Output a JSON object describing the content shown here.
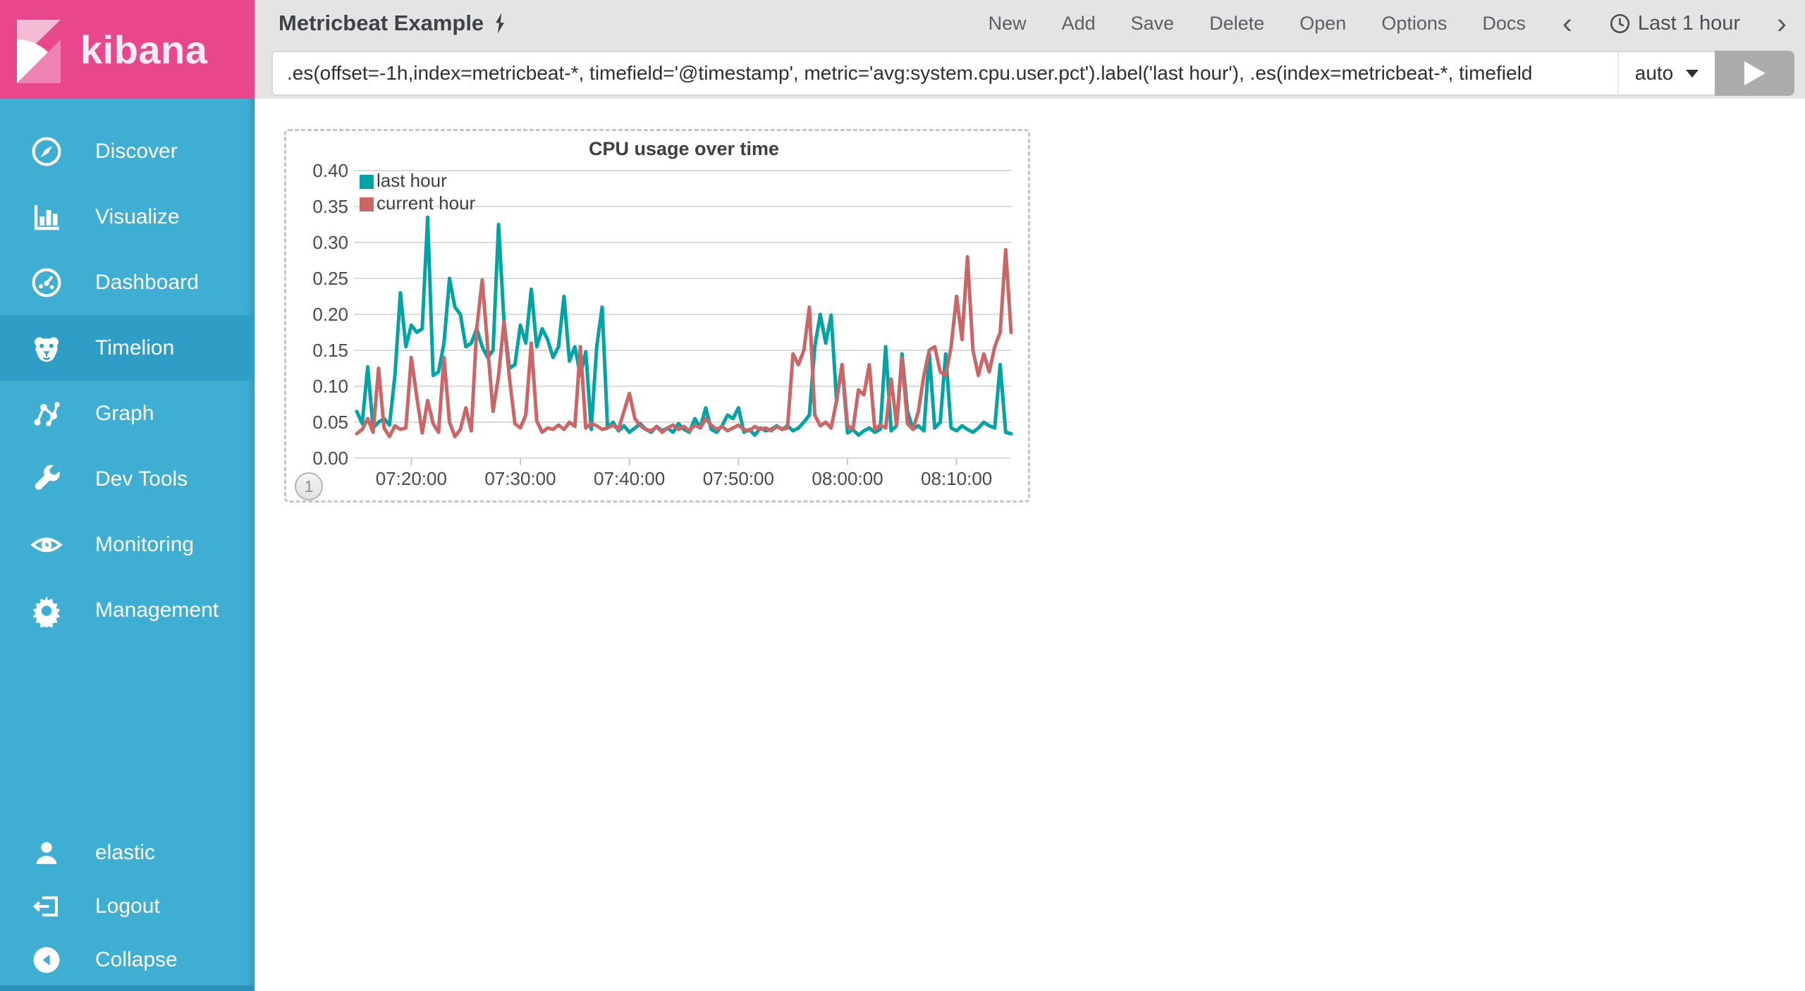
{
  "app": {
    "logo_text": "kibana"
  },
  "sidebar": {
    "items": [
      {
        "label": "Discover",
        "icon": "compass-icon",
        "active": false
      },
      {
        "label": "Visualize",
        "icon": "barchart-icon",
        "active": false
      },
      {
        "label": "Dashboard",
        "icon": "gauge-icon",
        "active": false
      },
      {
        "label": "Timelion",
        "icon": "lion-icon",
        "active": true
      },
      {
        "label": "Graph",
        "icon": "graph-icon",
        "active": false
      },
      {
        "label": "Dev Tools",
        "icon": "wrench-icon",
        "active": false
      },
      {
        "label": "Monitoring",
        "icon": "eye-icon",
        "active": false
      },
      {
        "label": "Management",
        "icon": "gear-icon",
        "active": false
      }
    ],
    "footer_items": [
      {
        "label": "elastic",
        "icon": "user-icon"
      },
      {
        "label": "Logout",
        "icon": "logout-icon"
      },
      {
        "label": "Collapse",
        "icon": "collapse-icon"
      }
    ]
  },
  "topbar": {
    "title": "Metricbeat Example",
    "title_icon": "lightning-bolt-icon",
    "menu": [
      "New",
      "Add",
      "Save",
      "Delete",
      "Open",
      "Options",
      "Docs"
    ],
    "time_picker": {
      "icon": "clock-icon",
      "label": "Last 1 hour"
    }
  },
  "query_bar": {
    "value": ".es(offset=-1h,index=metricbeat-*, timefield='@timestamp', metric='avg:system.cpu.user.pct').label('last hour'), .es(index=metricbeat-*, timefield",
    "interval": "auto",
    "run_icon": "play-icon"
  },
  "panel": {
    "badge": "1"
  },
  "colors": {
    "sidebar": "#3EAED2",
    "sidebar_active": "#2E9EC6",
    "brand_pink": "#E8488B",
    "topbar": "#E4E4E4",
    "series_teal": "#01A4A4",
    "series_red": "#CC6666",
    "grid": "#DBDBDB",
    "axis_text": "#4A4A4A"
  },
  "chart_data": {
    "type": "line",
    "title": "CPU usage over time",
    "xlabel": "",
    "ylabel": "",
    "x_range": [
      "07:15:00",
      "08:15:00"
    ],
    "interval_seconds": 30,
    "x_ticks": [
      "07:20:00",
      "07:30:00",
      "07:40:00",
      "07:50:00",
      "08:00:00",
      "08:10:00"
    ],
    "x_tick_minutes_from_start": [
      5,
      15,
      25,
      35,
      45,
      55
    ],
    "y_ticks": [
      "0.00",
      "0.05",
      "0.10",
      "0.15",
      "0.20",
      "0.25",
      "0.30",
      "0.35",
      "0.40"
    ],
    "ylim": [
      0,
      0.4
    ],
    "grid": true,
    "legend_position": "top-left",
    "series": [
      {
        "name": "last hour",
        "color": "#01A4A4",
        "values": [
          0.065,
          0.048,
          0.127,
          0.042,
          0.05,
          0.055,
          0.046,
          0.115,
          0.23,
          0.155,
          0.185,
          0.175,
          0.18,
          0.335,
          0.115,
          0.12,
          0.16,
          0.25,
          0.21,
          0.2,
          0.155,
          0.16,
          0.18,
          0.155,
          0.14,
          0.15,
          0.325,
          0.19,
          0.125,
          0.13,
          0.185,
          0.16,
          0.235,
          0.155,
          0.18,
          0.165,
          0.14,
          0.155,
          0.225,
          0.135,
          0.155,
          0.115,
          0.148,
          0.04,
          0.155,
          0.21,
          0.042,
          0.05,
          0.038,
          0.045,
          0.036,
          0.042,
          0.048,
          0.04,
          0.036,
          0.044,
          0.038,
          0.042,
          0.036,
          0.048,
          0.04,
          0.036,
          0.055,
          0.042,
          0.07,
          0.04,
          0.036,
          0.045,
          0.06,
          0.055,
          0.07,
          0.036,
          0.04,
          0.032,
          0.042,
          0.038,
          0.04,
          0.045,
          0.04,
          0.045,
          0.038,
          0.042,
          0.05,
          0.06,
          0.155,
          0.2,
          0.16,
          0.199,
          0.08,
          0.13,
          0.035,
          0.04,
          0.032,
          0.038,
          0.042,
          0.036,
          0.04,
          0.155,
          0.038,
          0.045,
          0.145,
          0.065,
          0.04,
          0.045,
          0.038,
          0.145,
          0.042,
          0.05,
          0.145,
          0.042,
          0.038,
          0.045,
          0.04,
          0.036,
          0.042,
          0.05,
          0.045,
          0.042,
          0.13,
          0.036,
          0.034
        ]
      },
      {
        "name": "current hour",
        "color": "#CC6666",
        "values": [
          0.034,
          0.04,
          0.055,
          0.036,
          0.125,
          0.042,
          0.03,
          0.045,
          0.04,
          0.042,
          0.14,
          0.085,
          0.035,
          0.08,
          0.048,
          0.036,
          0.14,
          0.05,
          0.03,
          0.04,
          0.07,
          0.038,
          0.18,
          0.248,
          0.155,
          0.065,
          0.115,
          0.19,
          0.112,
          0.048,
          0.042,
          0.06,
          0.16,
          0.052,
          0.036,
          0.042,
          0.04,
          0.046,
          0.04,
          0.05,
          0.044,
          0.155,
          0.042,
          0.048,
          0.045,
          0.04,
          0.042,
          0.046,
          0.04,
          0.065,
          0.09,
          0.055,
          0.045,
          0.04,
          0.038,
          0.044,
          0.036,
          0.042,
          0.046,
          0.04,
          0.044,
          0.038,
          0.046,
          0.042,
          0.055,
          0.046,
          0.04,
          0.044,
          0.038,
          0.042,
          0.046,
          0.04,
          0.038,
          0.044,
          0.04,
          0.042,
          0.038,
          0.044,
          0.04,
          0.042,
          0.145,
          0.13,
          0.15,
          0.21,
          0.06,
          0.045,
          0.05,
          0.042,
          0.08,
          0.13,
          0.046,
          0.04,
          0.095,
          0.088,
          0.13,
          0.04,
          0.046,
          0.042,
          0.11,
          0.046,
          0.14,
          0.048,
          0.04,
          0.065,
          0.115,
          0.15,
          0.155,
          0.12,
          0.115,
          0.155,
          0.225,
          0.165,
          0.28,
          0.15,
          0.115,
          0.145,
          0.12,
          0.155,
          0.175,
          0.29,
          0.175
        ]
      }
    ]
  }
}
